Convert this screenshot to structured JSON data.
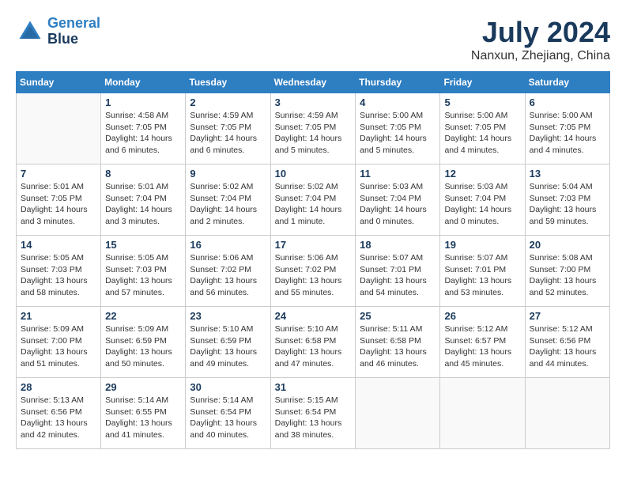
{
  "header": {
    "logo_line1": "General",
    "logo_line2": "Blue",
    "month": "July 2024",
    "location": "Nanxun, Zhejiang, China"
  },
  "columns": [
    "Sunday",
    "Monday",
    "Tuesday",
    "Wednesday",
    "Thursday",
    "Friday",
    "Saturday"
  ],
  "weeks": [
    [
      {
        "day": "",
        "info": ""
      },
      {
        "day": "1",
        "info": "Sunrise: 4:58 AM\nSunset: 7:05 PM\nDaylight: 14 hours\nand 6 minutes."
      },
      {
        "day": "2",
        "info": "Sunrise: 4:59 AM\nSunset: 7:05 PM\nDaylight: 14 hours\nand 6 minutes."
      },
      {
        "day": "3",
        "info": "Sunrise: 4:59 AM\nSunset: 7:05 PM\nDaylight: 14 hours\nand 5 minutes."
      },
      {
        "day": "4",
        "info": "Sunrise: 5:00 AM\nSunset: 7:05 PM\nDaylight: 14 hours\nand 5 minutes."
      },
      {
        "day": "5",
        "info": "Sunrise: 5:00 AM\nSunset: 7:05 PM\nDaylight: 14 hours\nand 4 minutes."
      },
      {
        "day": "6",
        "info": "Sunrise: 5:00 AM\nSunset: 7:05 PM\nDaylight: 14 hours\nand 4 minutes."
      }
    ],
    [
      {
        "day": "7",
        "info": "Sunrise: 5:01 AM\nSunset: 7:05 PM\nDaylight: 14 hours\nand 3 minutes."
      },
      {
        "day": "8",
        "info": "Sunrise: 5:01 AM\nSunset: 7:04 PM\nDaylight: 14 hours\nand 3 minutes."
      },
      {
        "day": "9",
        "info": "Sunrise: 5:02 AM\nSunset: 7:04 PM\nDaylight: 14 hours\nand 2 minutes."
      },
      {
        "day": "10",
        "info": "Sunrise: 5:02 AM\nSunset: 7:04 PM\nDaylight: 14 hours\nand 1 minute."
      },
      {
        "day": "11",
        "info": "Sunrise: 5:03 AM\nSunset: 7:04 PM\nDaylight: 14 hours\nand 0 minutes."
      },
      {
        "day": "12",
        "info": "Sunrise: 5:03 AM\nSunset: 7:04 PM\nDaylight: 14 hours\nand 0 minutes."
      },
      {
        "day": "13",
        "info": "Sunrise: 5:04 AM\nSunset: 7:03 PM\nDaylight: 13 hours\nand 59 minutes."
      }
    ],
    [
      {
        "day": "14",
        "info": "Sunrise: 5:05 AM\nSunset: 7:03 PM\nDaylight: 13 hours\nand 58 minutes."
      },
      {
        "day": "15",
        "info": "Sunrise: 5:05 AM\nSunset: 7:03 PM\nDaylight: 13 hours\nand 57 minutes."
      },
      {
        "day": "16",
        "info": "Sunrise: 5:06 AM\nSunset: 7:02 PM\nDaylight: 13 hours\nand 56 minutes."
      },
      {
        "day": "17",
        "info": "Sunrise: 5:06 AM\nSunset: 7:02 PM\nDaylight: 13 hours\nand 55 minutes."
      },
      {
        "day": "18",
        "info": "Sunrise: 5:07 AM\nSunset: 7:01 PM\nDaylight: 13 hours\nand 54 minutes."
      },
      {
        "day": "19",
        "info": "Sunrise: 5:07 AM\nSunset: 7:01 PM\nDaylight: 13 hours\nand 53 minutes."
      },
      {
        "day": "20",
        "info": "Sunrise: 5:08 AM\nSunset: 7:00 PM\nDaylight: 13 hours\nand 52 minutes."
      }
    ],
    [
      {
        "day": "21",
        "info": "Sunrise: 5:09 AM\nSunset: 7:00 PM\nDaylight: 13 hours\nand 51 minutes."
      },
      {
        "day": "22",
        "info": "Sunrise: 5:09 AM\nSunset: 6:59 PM\nDaylight: 13 hours\nand 50 minutes."
      },
      {
        "day": "23",
        "info": "Sunrise: 5:10 AM\nSunset: 6:59 PM\nDaylight: 13 hours\nand 49 minutes."
      },
      {
        "day": "24",
        "info": "Sunrise: 5:10 AM\nSunset: 6:58 PM\nDaylight: 13 hours\nand 47 minutes."
      },
      {
        "day": "25",
        "info": "Sunrise: 5:11 AM\nSunset: 6:58 PM\nDaylight: 13 hours\nand 46 minutes."
      },
      {
        "day": "26",
        "info": "Sunrise: 5:12 AM\nSunset: 6:57 PM\nDaylight: 13 hours\nand 45 minutes."
      },
      {
        "day": "27",
        "info": "Sunrise: 5:12 AM\nSunset: 6:56 PM\nDaylight: 13 hours\nand 44 minutes."
      }
    ],
    [
      {
        "day": "28",
        "info": "Sunrise: 5:13 AM\nSunset: 6:56 PM\nDaylight: 13 hours\nand 42 minutes."
      },
      {
        "day": "29",
        "info": "Sunrise: 5:14 AM\nSunset: 6:55 PM\nDaylight: 13 hours\nand 41 minutes."
      },
      {
        "day": "30",
        "info": "Sunrise: 5:14 AM\nSunset: 6:54 PM\nDaylight: 13 hours\nand 40 minutes."
      },
      {
        "day": "31",
        "info": "Sunrise: 5:15 AM\nSunset: 6:54 PM\nDaylight: 13 hours\nand 38 minutes."
      },
      {
        "day": "",
        "info": ""
      },
      {
        "day": "",
        "info": ""
      },
      {
        "day": "",
        "info": ""
      }
    ]
  ]
}
